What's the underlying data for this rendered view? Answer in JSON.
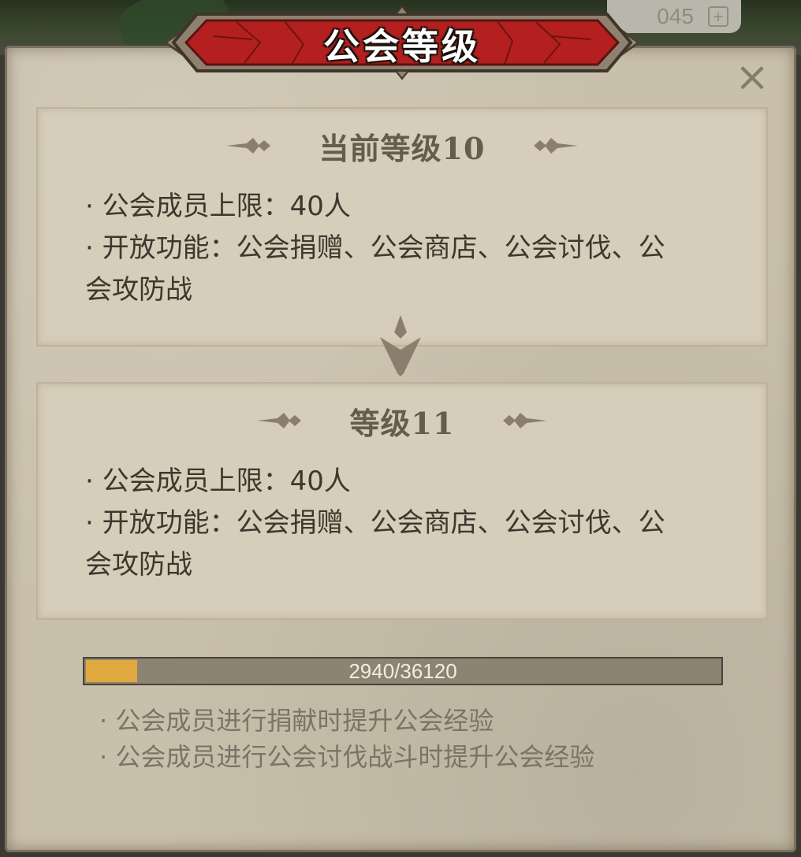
{
  "header": {
    "title": "公会等级",
    "currency_partial": "045",
    "plus_label": "+"
  },
  "close": {
    "label": "×"
  },
  "current_level": {
    "title": "当前等级10",
    "lines": [
      "· 公会成员上限：40人",
      "· 开放功能：公会捐赠、公会商店、公会讨伐、公会攻防战"
    ]
  },
  "next_level": {
    "title": "等级11",
    "lines": [
      "· 公会成员上限：40人",
      "· 开放功能：公会捐赠、公会商店、公会讨伐、公会攻防战"
    ]
  },
  "progress": {
    "current": 2940,
    "max": 36120,
    "label": "2940/36120",
    "fill_color": "#e0a93f"
  },
  "hints": [
    "· 公会成员进行捐献时提升公会经验",
    "· 公会成员进行公会讨伐战斗时提升公会经验"
  ],
  "colors": {
    "banner_red": "#b3201f",
    "panel_bg": "#c9c0ab",
    "card_bg": "#d6ceba"
  }
}
